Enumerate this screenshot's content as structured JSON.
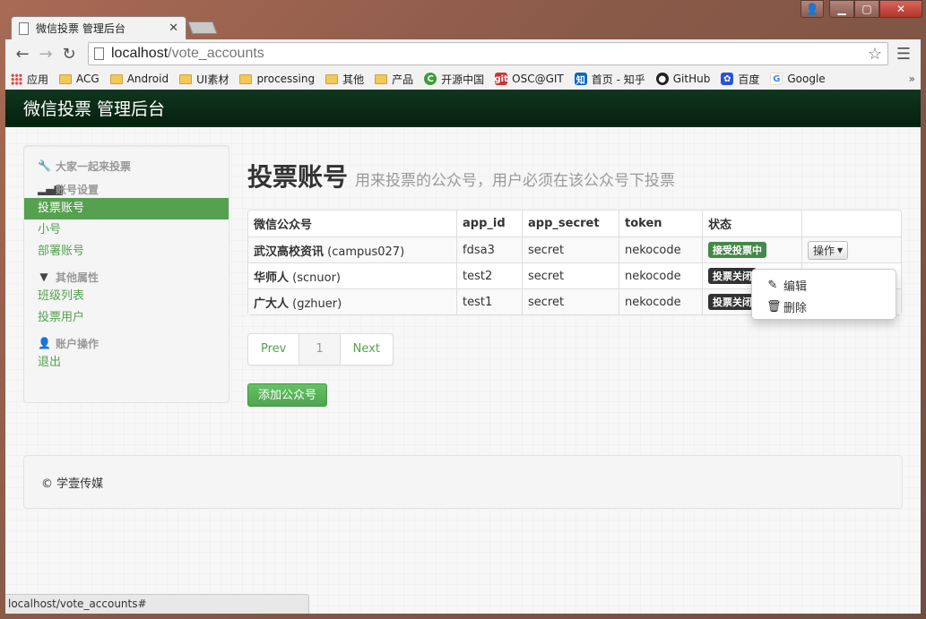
{
  "browser": {
    "tab_title": "微信投票 管理后台",
    "url_host": "localhost",
    "url_path": "/vote_accounts",
    "status_url": "localhost/vote_accounts#",
    "bookmarks": [
      "应用",
      "ACG",
      "Android",
      "UI素材",
      "processing",
      "其他",
      "产品",
      "开源中国",
      "OSC@GIT",
      "首页 - 知乎",
      "GitHub",
      "百度",
      "Google"
    ],
    "bookmarks_more": "»"
  },
  "app": {
    "brand": "微信投票 管理后台"
  },
  "sidebar": {
    "header1": "大家一起来投票",
    "header2": "账号设置",
    "item_vote_accounts": "投票账号",
    "item_small": "小号",
    "item_deploy": "部署账号",
    "header3": "其他属性",
    "item_classes": "班级列表",
    "item_voters": "投票用户",
    "header4": "账户操作",
    "item_logout": "退出"
  },
  "main": {
    "title": "投票账号",
    "subtitle": "用来投票的公众号，用户必须在该公众号下投票",
    "columns": [
      "微信公众号",
      "app_id",
      "app_secret",
      "token",
      "状态",
      ""
    ],
    "rows": [
      {
        "name": "武汉高校资讯",
        "handle": "(campus027)",
        "app_id": "fdsa3",
        "app_secret": "secret",
        "token": "nekocode",
        "status": "接受投票中",
        "status_type": "success"
      },
      {
        "name": "华师人",
        "handle": "(scnuor)",
        "app_id": "test2",
        "app_secret": "secret",
        "token": "nekocode",
        "status": "投票关闭",
        "status_type": "inverse"
      },
      {
        "name": "广大人",
        "handle": "(gzhuer)",
        "app_id": "test1",
        "app_secret": "secret",
        "token": "nekocode",
        "status": "投票关闭",
        "status_type": "inverse"
      }
    ],
    "op_label": "操作",
    "dropdown": {
      "edit": "编辑",
      "delete": "删除"
    },
    "pagination": {
      "prev": "Prev",
      "page": "1",
      "next": "Next"
    },
    "add_label": "添加公众号"
  },
  "footer": {
    "text": "© 学壹传媒"
  },
  "colors": {
    "accent": "#55a14f",
    "navbar": "#0d2f18",
    "success": "#468847",
    "inverse": "#333333"
  }
}
